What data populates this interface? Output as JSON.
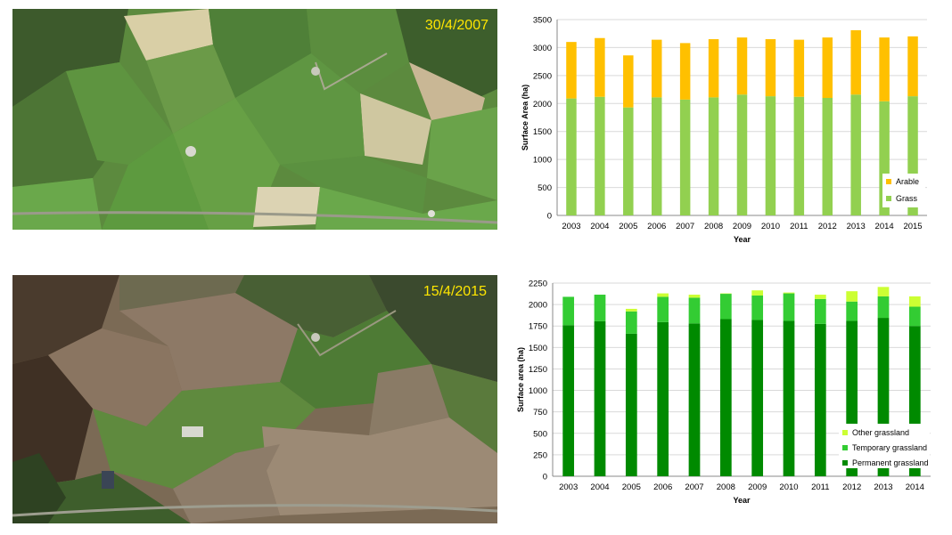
{
  "photos": [
    {
      "date": "30/4/2007"
    },
    {
      "date": "15/4/2015"
    }
  ],
  "colors": {
    "arable": "#ffc000",
    "grass": "#92d050",
    "permanent": "#008a00",
    "temporary": "#33cc33",
    "other": "#ccff33",
    "date_text": "#ffe600"
  },
  "chart_data": [
    {
      "type": "bar",
      "stacked": true,
      "categories": [
        "2003",
        "2004",
        "2005",
        "2006",
        "2007",
        "2008",
        "2009",
        "2010",
        "2011",
        "2012",
        "2013",
        "2014",
        "2015"
      ],
      "series": [
        {
          "name": "Grass",
          "values": [
            2090,
            2120,
            1930,
            2110,
            2070,
            2110,
            2160,
            2130,
            2120,
            2100,
            2160,
            2040,
            2130
          ]
        },
        {
          "name": "Arable",
          "values": [
            1010,
            1050,
            930,
            1030,
            1010,
            1040,
            1020,
            1020,
            1020,
            1080,
            1150,
            1140,
            1070
          ]
        }
      ],
      "title": "",
      "xlabel": "Year",
      "ylabel": "Surface Area (ha)",
      "ylim": [
        0,
        3500
      ],
      "yticks": [
        "0",
        "500",
        "1000",
        "1500",
        "2000",
        "2500",
        "3000",
        "3500"
      ],
      "grid": true,
      "legend_position": "bottom-right",
      "legend": [
        "Arable",
        "Grass"
      ]
    },
    {
      "type": "bar",
      "stacked": true,
      "categories": [
        "2003",
        "2004",
        "2005",
        "2006",
        "2007",
        "2008",
        "2009",
        "2010",
        "2011",
        "2012",
        "2013",
        "2014"
      ],
      "series": [
        {
          "name": "Permanent grassland",
          "values": [
            1760,
            1805,
            1660,
            1795,
            1780,
            1830,
            1820,
            1810,
            1775,
            1810,
            1845,
            1750
          ]
        },
        {
          "name": "Temporary grassland",
          "values": [
            330,
            310,
            260,
            295,
            300,
            295,
            285,
            320,
            290,
            225,
            250,
            225
          ]
        },
        {
          "name": "Other grassland",
          "values": [
            0,
            0,
            30,
            40,
            35,
            5,
            60,
            10,
            50,
            120,
            110,
            120
          ]
        }
      ],
      "title": "",
      "xlabel": "Year",
      "ylabel": "Surface area (ha)",
      "ylim": [
        0,
        2250
      ],
      "yticks": [
        "0",
        "250",
        "500",
        "750",
        "1000",
        "1250",
        "1500",
        "1750",
        "2000",
        "2250"
      ],
      "grid": true,
      "legend_position": "bottom-right",
      "legend": [
        "Other grassland",
        "Temporary grassland",
        "Permanent grassland"
      ]
    }
  ]
}
